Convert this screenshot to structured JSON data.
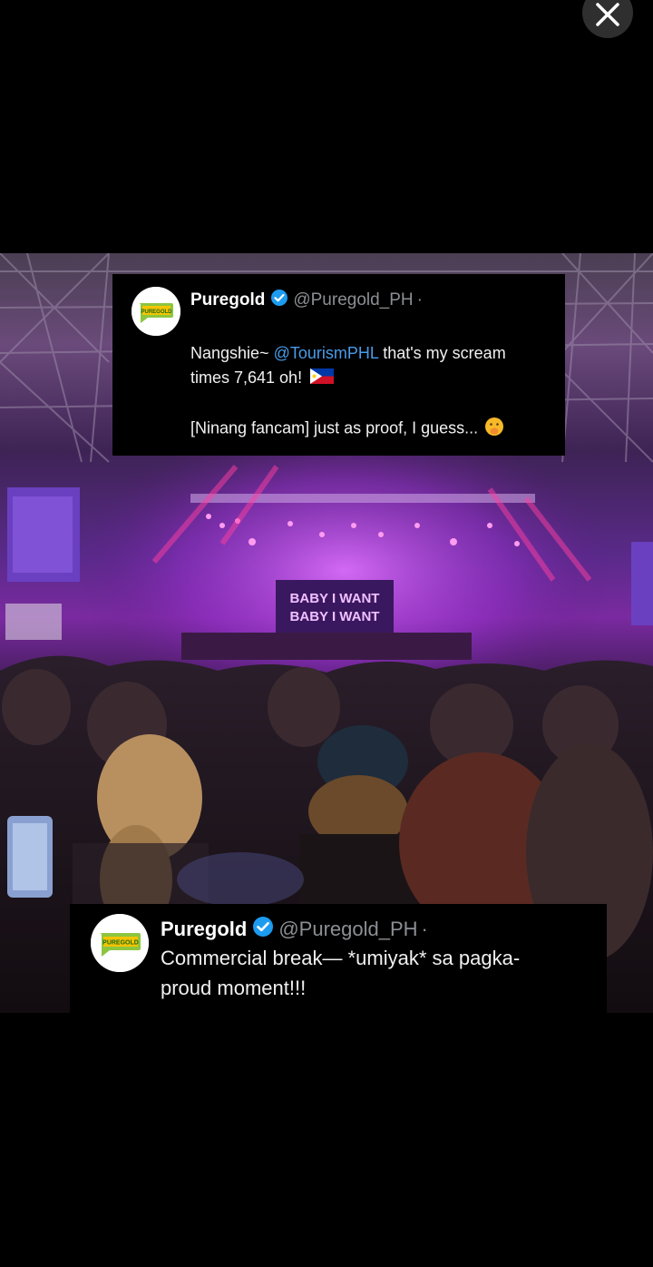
{
  "viewer": {
    "close_icon": "close-icon"
  },
  "tweet_top": {
    "name": "Puregold",
    "handle": "@Puregold_PH",
    "separator": "·",
    "line1_before": "Nangshie~ ",
    "line1_mention": "@TourismPHL",
    "line1_after": " that's my scream",
    "line2": "times 7,641 oh!",
    "line3": "[Ninang fancam] just as proof, I guess...",
    "avatar_text": "PUREGOLD"
  },
  "tweet_bottom": {
    "name": "Puregold",
    "handle": "@Puregold_PH",
    "separator": "·",
    "line1": "Commercial break— *umiyak* sa pagka-",
    "line2": "proud moment!!!",
    "avatar_text": "PUREGOLD"
  },
  "stage_screen_text": [
    "BABY I WANT",
    "BABY I WANT"
  ],
  "colors": {
    "verified": "#1d9bf0",
    "mention": "#4a9be8",
    "handle": "#8b8f94",
    "brand_green": "#8cc63f",
    "brand_yellow": "#f5c400"
  }
}
